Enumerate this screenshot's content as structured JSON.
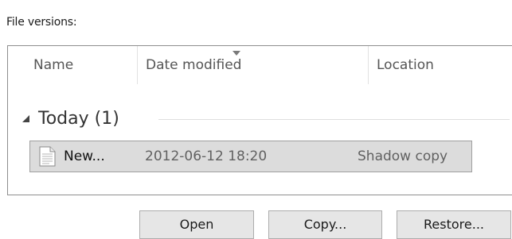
{
  "section_label": "File versions:",
  "columns": {
    "name": "Name",
    "date_modified": "Date modified",
    "location": "Location"
  },
  "group": {
    "title": "Today (1)"
  },
  "rows": [
    {
      "name": "New...",
      "date_modified": "2012-06-12 18:20",
      "location": "Shadow copy",
      "icon": "text-document-icon",
      "selected": true
    }
  ],
  "buttons": {
    "open": "Open",
    "copy": "Copy...",
    "restore": "Restore..."
  },
  "colors": {
    "selected_row_bg": "#dcdcdc",
    "button_bg": "#e6e6e6",
    "border": "#8e8e8e"
  }
}
